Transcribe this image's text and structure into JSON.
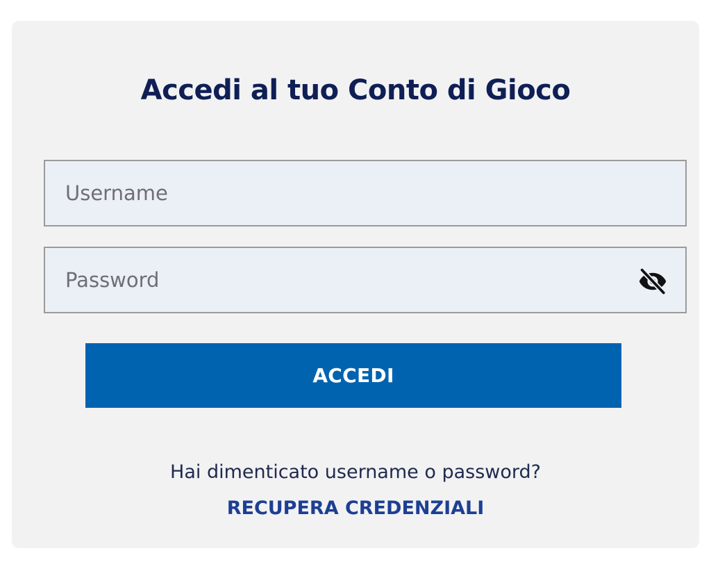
{
  "login": {
    "title": "Accedi al tuo Conto di Gioco",
    "username_placeholder": "Username",
    "username_value": "",
    "password_placeholder": "Password",
    "password_value": "",
    "password_toggle_icon": "eye-off-icon",
    "submit_label": "ACCEDI",
    "forgot_text": "Hai dimenticato username o password?",
    "recover_link": "RECUPERA CREDENZIALI"
  },
  "colors": {
    "card_bg": "#f2f2f3",
    "title": "#0f1f55",
    "input_bg": "#ebeff6",
    "input_border": "#9a9a9a",
    "button_bg": "#0063b0",
    "button_text": "#ffffff",
    "link": "#1d3f93"
  }
}
